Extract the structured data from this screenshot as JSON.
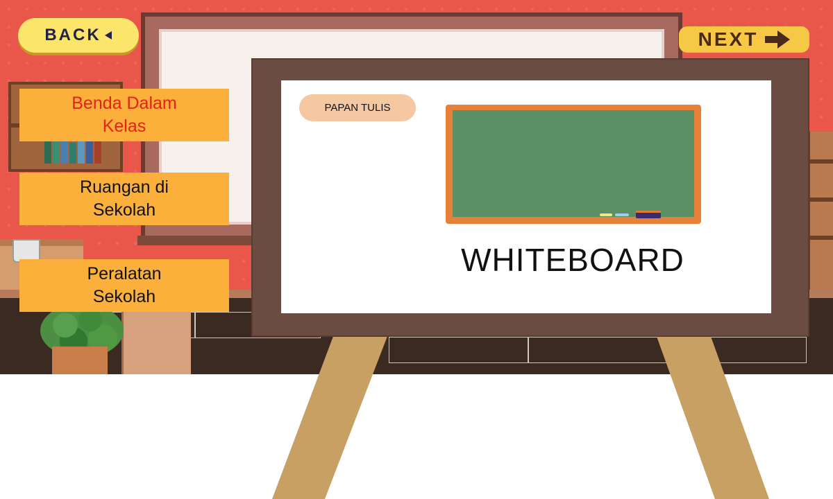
{
  "nav": {
    "back_label": "BACK",
    "next_label": "NEXT"
  },
  "menu": {
    "items": [
      {
        "line1": "Benda Dalam",
        "line2": "Kelas",
        "active": true
      },
      {
        "line1": "Ruangan di",
        "line2": "Sekolah",
        "active": false
      },
      {
        "line1": "Peralatan",
        "line2": "Sekolah",
        "active": false
      }
    ]
  },
  "card": {
    "tag_label": "PAPAN TULIS",
    "word": "WHITEBOARD",
    "image_icon": "chalkboard-icon"
  },
  "colors": {
    "wall": "#e8574a",
    "button_yellow": "#fbb03b",
    "active_text": "#e8201c",
    "easel_frame": "#6b4c42",
    "easel_leg": "#c8a063",
    "chalkboard_green": "#5c8f63",
    "chalkboard_frame": "#e6813a"
  }
}
